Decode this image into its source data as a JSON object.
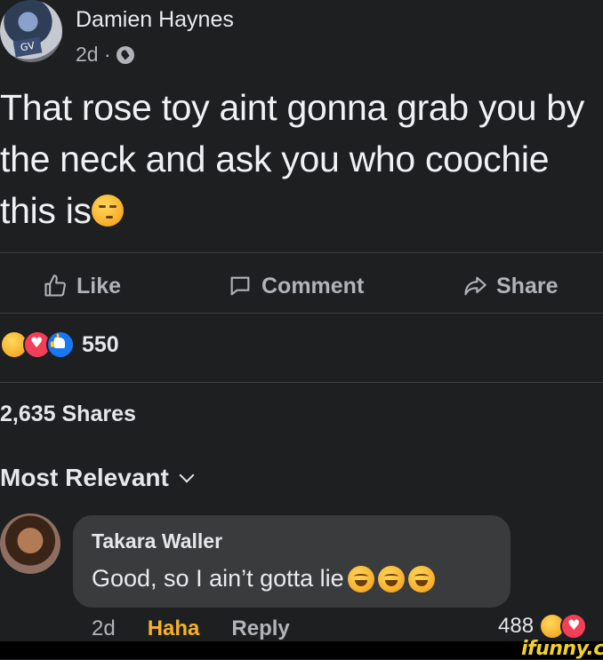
{
  "post": {
    "author": "Damien Haynes",
    "time": "2d ·",
    "text": "That rose toy aint gonna grab you by the neck and ask you who coochie this is",
    "emoji_after_text": "smirk-emoji"
  },
  "actions": {
    "like": "Like",
    "comment": "Comment",
    "share": "Share"
  },
  "reactions": {
    "types": [
      "haha",
      "love",
      "like"
    ],
    "count": "550"
  },
  "shares_text": "2,635 Shares",
  "sort_label": "Most Relevant",
  "comment": {
    "author": "Takara Waller",
    "text": "Good, so I ain’t gotta lie",
    "emojis": [
      "laughing-tears-emoji",
      "laughing-tears-emoji",
      "laughing-tears-emoji"
    ],
    "time": "2d",
    "haha_label": "Haha",
    "reply_label": "Reply",
    "reaction_count": "488"
  },
  "watermark": "ifunny.co",
  "colors": {
    "background": "#1e1f21",
    "bubble": "#3a3b3c",
    "haha": "#f7b125",
    "like_blue": "#1877f2",
    "love_red": "#f33e58"
  }
}
